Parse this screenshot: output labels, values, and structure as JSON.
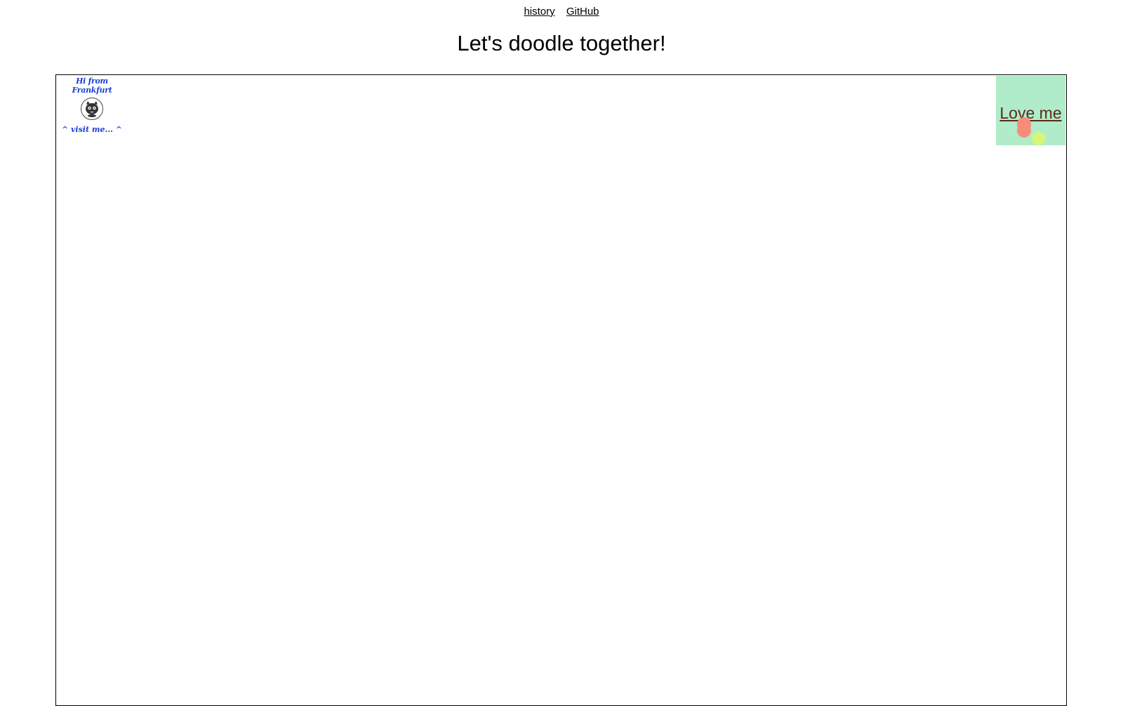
{
  "nav": {
    "history_label": "history",
    "github_label": "GitHub"
  },
  "page": {
    "title": "Let's doodle together!"
  },
  "canvas": {
    "greeting": {
      "text": "Hi from Frankfurt",
      "avatar_icon": "cat-face-icon",
      "visit_text": "^ visit me... ^"
    },
    "love_button": {
      "label": "Love me",
      "background_color": "#b0ecc9",
      "text_color": "#5a2a1a",
      "dot_colors": [
        "#f88c78",
        "#d4f77a"
      ]
    }
  },
  "colors": {
    "greeting_text": "#1a3fd6",
    "canvas_border": "#000000"
  }
}
